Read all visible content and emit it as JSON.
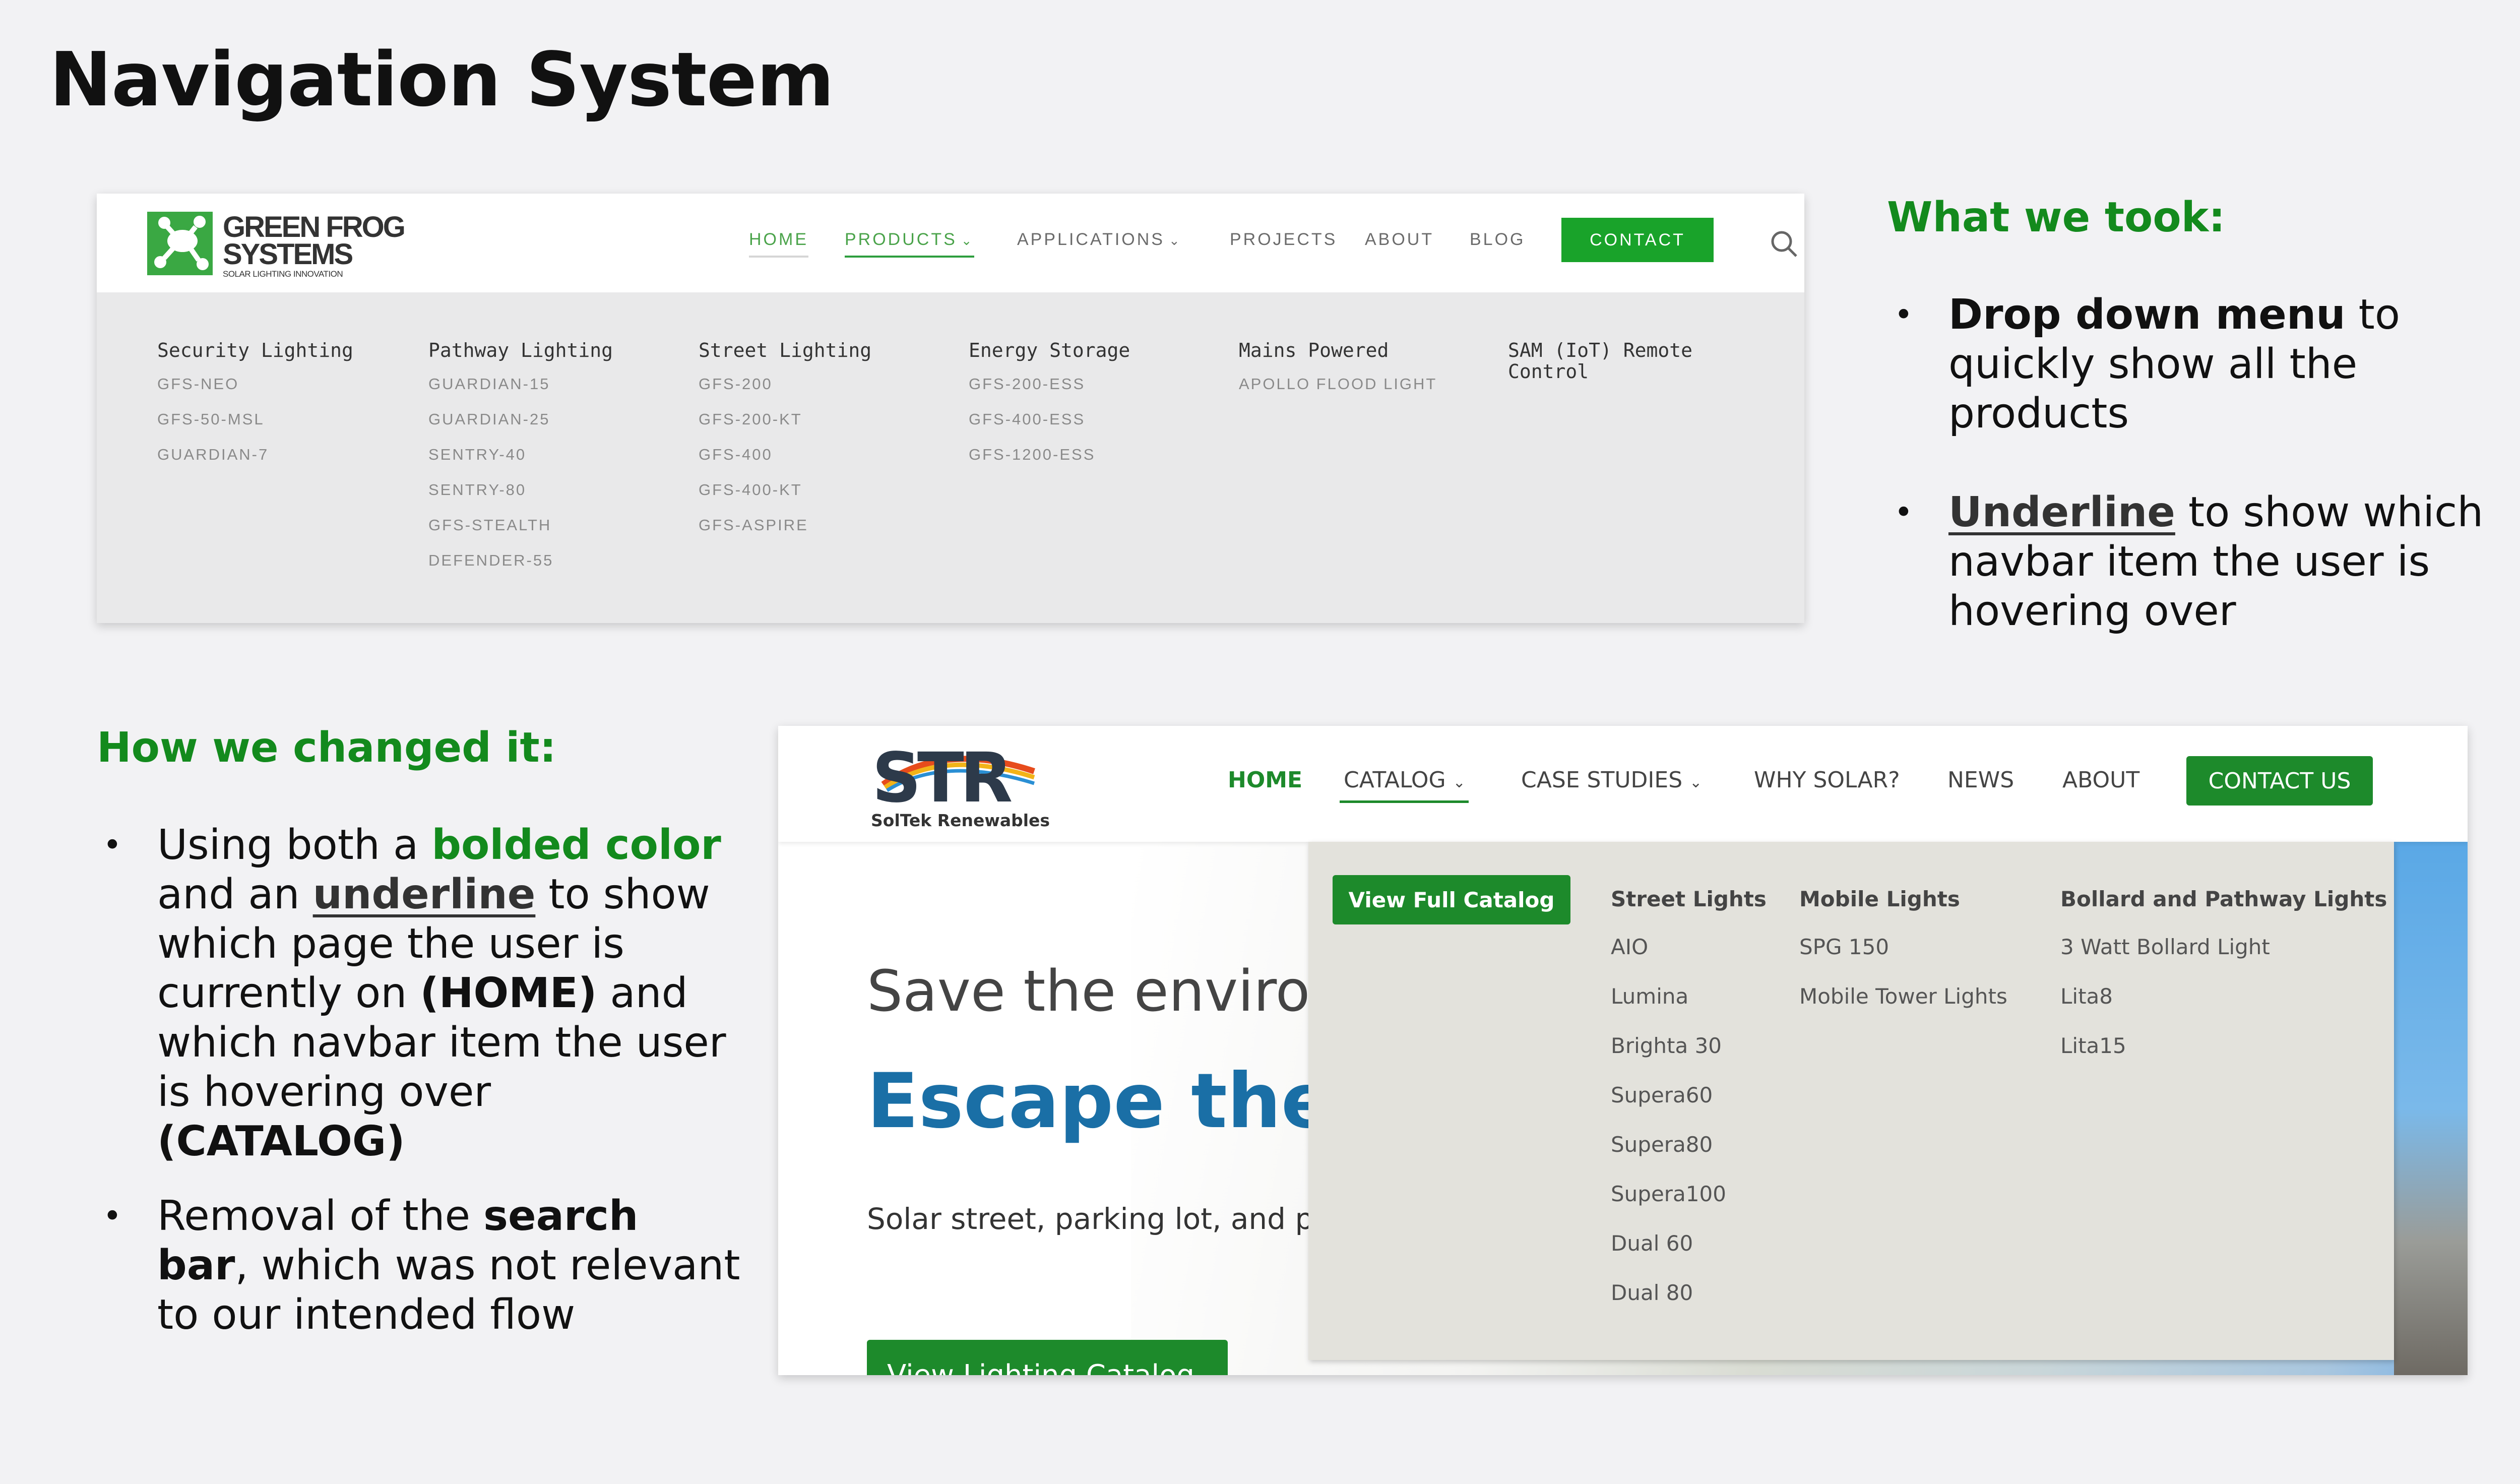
{
  "slide": {
    "title": "Navigation System"
  },
  "gfs": {
    "logo_line1": "GREEN FROG",
    "logo_line2": "SYSTEMS",
    "logo_tagline": "SOLAR LIGHTING INNOVATION",
    "nav": [
      "HOME",
      "PRODUCTS",
      "APPLICATIONS",
      "PROJECTS",
      "ABOUT",
      "BLOG"
    ],
    "contact": "CONTACT",
    "columns": [
      {
        "heading": "Security Lighting",
        "items": [
          "GFS-NEO",
          "GFS-50-MSL",
          "GUARDIAN-7"
        ]
      },
      {
        "heading": "Pathway Lighting",
        "items": [
          "GUARDIAN-15",
          "GUARDIAN-25",
          "SENTRY-40",
          "SENTRY-80",
          "GFS-STEALTH",
          "DEFENDER-55"
        ]
      },
      {
        "heading": "Street Lighting",
        "items": [
          "GFS-200",
          "GFS-200-KT",
          "GFS-400",
          "GFS-400-KT",
          "GFS-ASPIRE"
        ]
      },
      {
        "heading": "Energy Storage",
        "items": [
          "GFS-200-ESS",
          "GFS-400-ESS",
          "GFS-1200-ESS"
        ]
      },
      {
        "heading": "Mains Powered",
        "items": [
          "APOLLO FLOOD LIGHT"
        ]
      },
      {
        "heading": "SAM (IoT) Remote Control",
        "items": []
      }
    ]
  },
  "took": {
    "heading": "What we took:",
    "b1_bold": "Drop down menu",
    "b1_rest": " to quickly show all the products",
    "b2_under": "Underline",
    "b2_rest": " to show which navbar item the user is hovering over"
  },
  "changed": {
    "heading": "How we changed it:",
    "b1_a": "Using both a ",
    "b1_green": "bolded color",
    "b1_b": " and an ",
    "b1_under": "underline",
    "b1_c": " to show which page the user is currently on ",
    "b1_home": "(HOME)",
    "b1_d": " and which navbar item the user is hovering over ",
    "b1_catalog": "(CATALOG)",
    "b2_a": "Removal of the ",
    "b2_bold": "search bar",
    "b2_b": ", which was not relevant to our intended flow"
  },
  "str": {
    "logo_sub": "SolTek Renewables",
    "nav": {
      "home": "HOME",
      "catalog": "CATALOG",
      "case_studies": "CASE STUDIES",
      "why_solar": "WHY SOLAR?",
      "news": "NEWS",
      "about": "ABOUT"
    },
    "contact": "CONTACT US",
    "hero_line1": "Save the enviro",
    "hero_line2": "Escape the",
    "hero_line3": "Solar street, parking lot, and pat",
    "hero_button": "View Lighting Catalog",
    "dropdown": {
      "full_catalog": "View Full Catalog",
      "columns": [
        {
          "heading": "Street Lights",
          "items": [
            "AIO",
            "Lumina",
            "Brighta 30",
            "Supera60",
            "Supera80",
            "Supera100",
            "Dual 60",
            "Dual 80"
          ]
        },
        {
          "heading": "Mobile Lights",
          "items": [
            "SPG 150",
            "Mobile Tower Lights"
          ]
        },
        {
          "heading": "Bollard and Pathway Lights",
          "items": [
            "3 Watt Bollard Light",
            "Lita8",
            "Lita15"
          ]
        }
      ]
    }
  },
  "colors": {
    "accent_green": "#138a1d",
    "str_green": "#1d8a2b",
    "gfs_green": "#19a32a",
    "str_blue": "#1a6fa6"
  }
}
